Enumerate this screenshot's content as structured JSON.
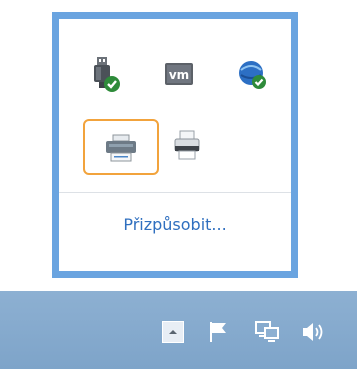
{
  "overflow_area": {
    "customize_link": "Přizpůsobit...",
    "icons": [
      {
        "name": "usb-safely-remove-icon",
        "selected": false
      },
      {
        "name": "vmware-tools-icon",
        "label": "vm",
        "selected": false
      },
      {
        "name": "network-globe-check-icon",
        "selected": false
      },
      {
        "name": "printer-icon",
        "selected": true
      },
      {
        "name": "printer-status-icon",
        "selected": false
      }
    ],
    "selection_color": "#f2a33c",
    "border_color": "#6aa4e0"
  },
  "taskbar": {
    "background": "#8db0d2",
    "icons": [
      "show-hidden-icons-arrow",
      "action-center-flag-icon",
      "network-icon",
      "volume-icon"
    ]
  }
}
